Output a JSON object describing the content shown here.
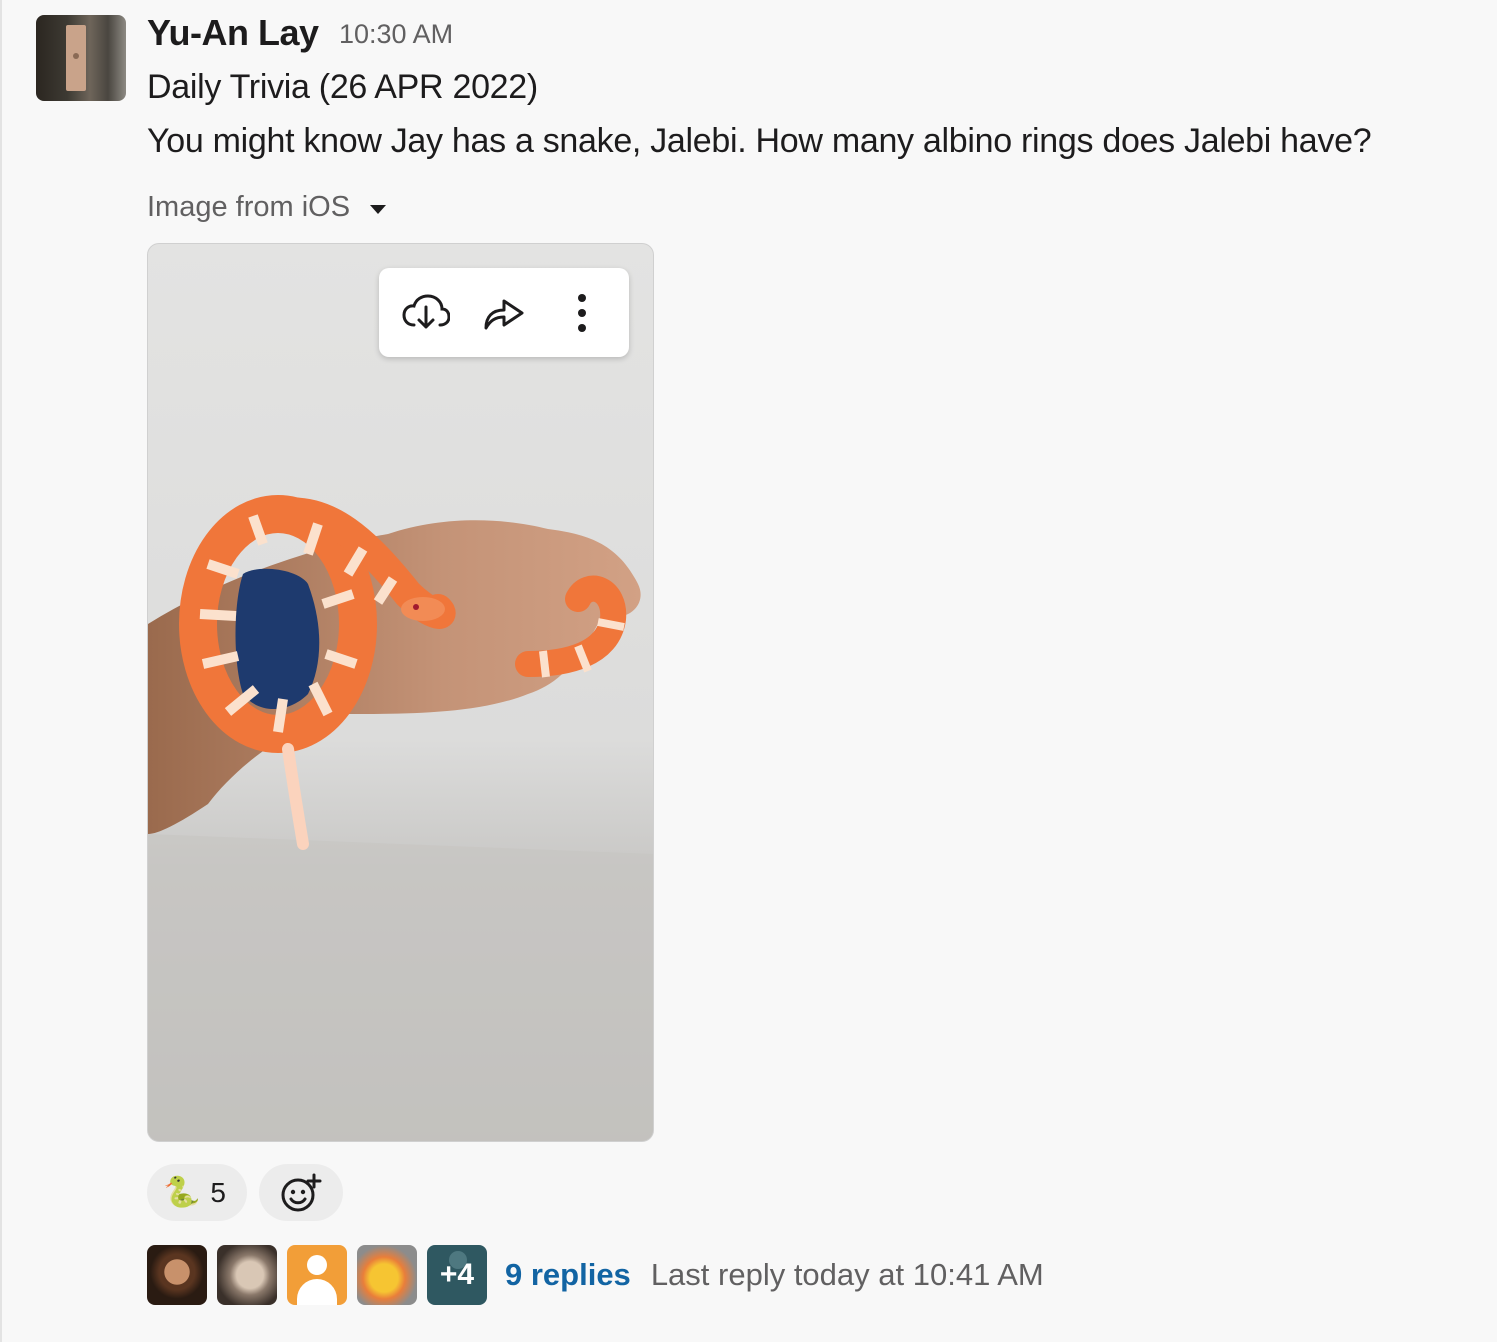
{
  "message": {
    "author": "Yu-An Lay",
    "timestamp": "10:30 AM",
    "title": "Daily Trivia (26 APR 2022)",
    "body": "You might know Jay has a snake, Jalebi. How many albino rings does Jalebi have?"
  },
  "attachment": {
    "label": "Image from iOS",
    "toolbar": {
      "icons": [
        "cloud-download-icon",
        "share-arrow-icon",
        "more-vertical-icon"
      ]
    }
  },
  "reactions": [
    {
      "emoji": "🐍",
      "count": "5"
    },
    {
      "icon": "add-reaction-icon"
    }
  ],
  "thread": {
    "more_count": "+4",
    "replies_label": "9 replies",
    "last_reply": "Last reply today at 10:41 AM"
  },
  "colors": {
    "background": "#f8f8f8",
    "link": "#1264a3",
    "muted_text": "#616061",
    "snake_orange": "#f0763a"
  }
}
